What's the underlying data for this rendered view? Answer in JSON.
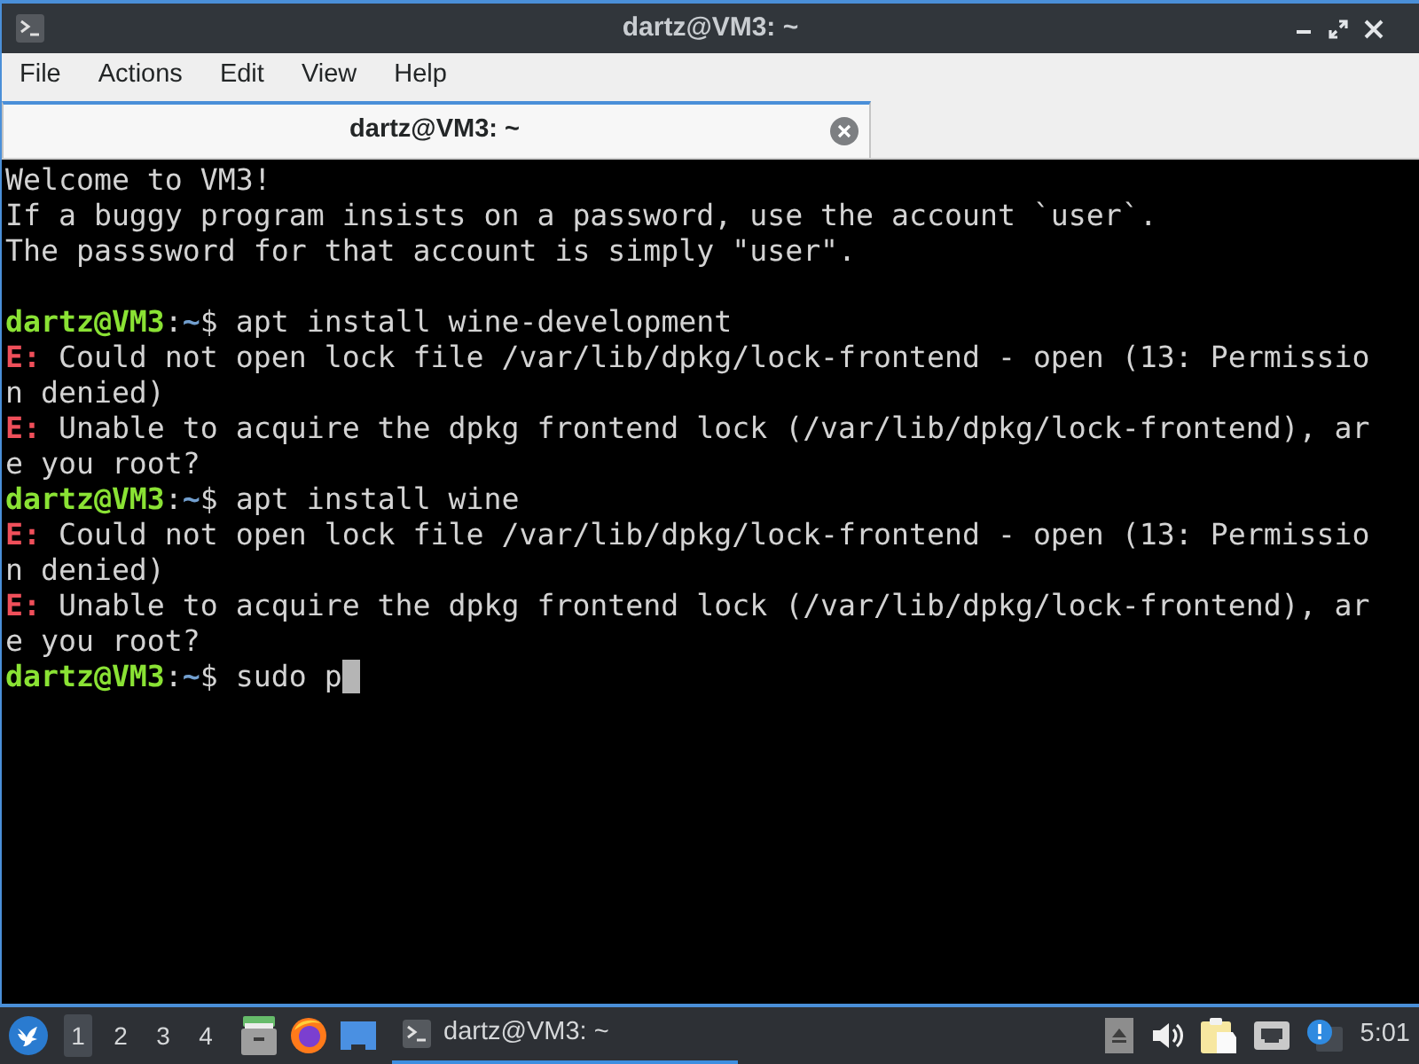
{
  "window": {
    "title": "dartz@VM3: ~"
  },
  "menu": [
    "File",
    "Actions",
    "Edit",
    "View",
    "Help"
  ],
  "tabs": [
    {
      "label": "dartz@VM3: ~",
      "selected": true
    }
  ],
  "terminal": {
    "lines": [
      {
        "kind": "output",
        "text": "Welcome to VM3!"
      },
      {
        "kind": "output",
        "text": "If a buggy program insists on a password, use the account `user`."
      },
      {
        "kind": "output",
        "text": "The passsword for that account is simply \"user\"."
      },
      {
        "kind": "blank"
      },
      {
        "kind": "prompt",
        "user": "dartz@VM3",
        "separator": ":",
        "path": "~",
        "sign": "$",
        "command": "apt install wine-development",
        "cursor": false
      },
      {
        "kind": "error",
        "label": "E:",
        "message": "Could not open lock file /var/lib/dpkg/lock-frontend - open (13: Permission denied)"
      },
      {
        "kind": "error",
        "label": "E:",
        "message": "Unable to acquire the dpkg frontend lock (/var/lib/dpkg/lock-frontend), are you root?"
      },
      {
        "kind": "prompt",
        "user": "dartz@VM3",
        "separator": ":",
        "path": "~",
        "sign": "$",
        "command": "apt install wine",
        "cursor": false
      },
      {
        "kind": "error",
        "label": "E:",
        "message": "Could not open lock file /var/lib/dpkg/lock-frontend - open (13: Permission denied)"
      },
      {
        "kind": "error",
        "label": "E:",
        "message": "Unable to acquire the dpkg frontend lock (/var/lib/dpkg/lock-frontend), are you root?"
      },
      {
        "kind": "prompt",
        "user": "dartz@VM3",
        "separator": ":",
        "path": "~",
        "sign": "$",
        "command": "sudo p",
        "cursor": true
      }
    ]
  },
  "taskbar": {
    "workspaces": [
      {
        "label": "1",
        "selected": true
      },
      {
        "label": "2",
        "selected": false
      },
      {
        "label": "3",
        "selected": false
      },
      {
        "label": "4",
        "selected": false
      }
    ],
    "tasks": [
      {
        "label": "dartz@VM3: ~",
        "selected": true
      }
    ],
    "clock": "5:01"
  }
}
